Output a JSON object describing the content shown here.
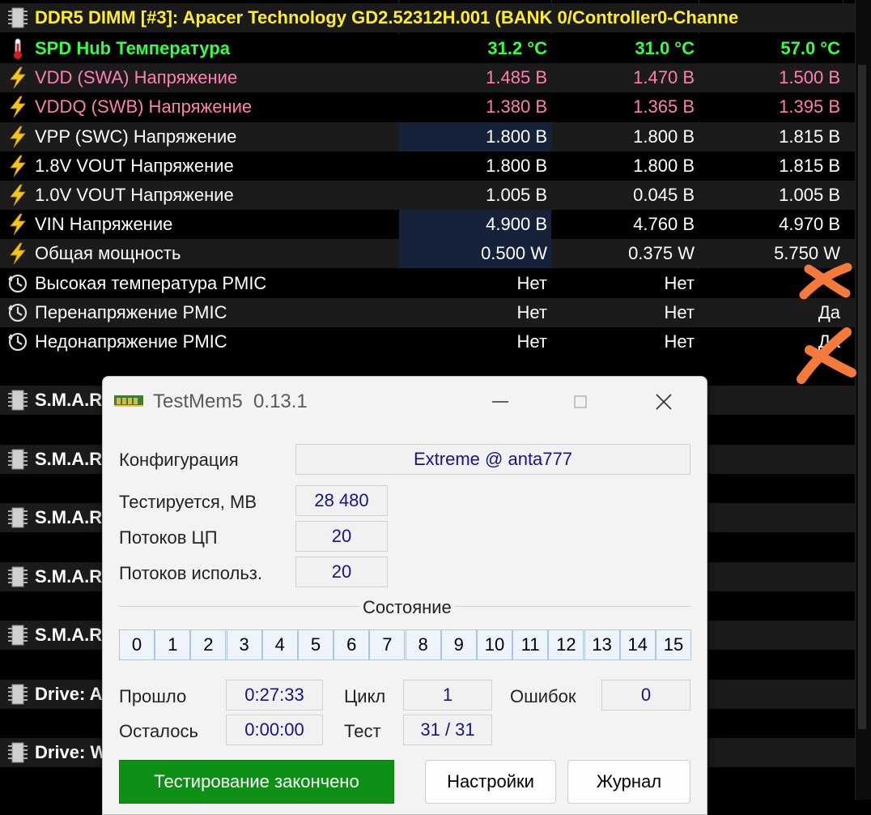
{
  "sensor": {
    "header": "DDR5 DIMM [#3]: Apacer Technology GD2.52312H.001 (BANK 0/Controller0-Channe",
    "rows": [
      {
        "label": "SPD Hub Температура",
        "cur": "31.2 °C",
        "min": "31.0 °C",
        "max": "57.0 °C",
        "icon": "thermometer-icon"
      },
      {
        "label": "VDD (SWA) Напряжение",
        "cur": "1.485 В",
        "min": "1.470 В",
        "max": "1.500 В",
        "icon": "bolt-icon"
      },
      {
        "label": "VDDQ (SWB) Напряжение",
        "cur": "1.380 В",
        "min": "1.365 В",
        "max": "1.395 В",
        "icon": "bolt-icon"
      },
      {
        "label": "VPP (SWC) Напряжение",
        "cur": "1.800 В",
        "min": "1.800 В",
        "max": "1.815 В",
        "icon": "bolt-icon"
      },
      {
        "label": "1.8V VOUT Напряжение",
        "cur": "1.800 В",
        "min": "1.800 В",
        "max": "1.815 В",
        "icon": "bolt-icon"
      },
      {
        "label": "1.0V VOUT Напряжение",
        "cur": "1.005 В",
        "min": "0.045 В",
        "max": "1.005 В",
        "icon": "bolt-icon"
      },
      {
        "label": "VIN Напряжение",
        "cur": "4.900 В",
        "min": "4.760 В",
        "max": "4.970 В",
        "icon": "bolt-icon"
      },
      {
        "label": "Общая мощность",
        "cur": "0.500 W",
        "min": "0.375 W",
        "max": "5.750 W",
        "icon": "bolt-icon"
      },
      {
        "label": "Высокая температура PMIC",
        "cur": "Нет",
        "min": "Нет",
        "max": "",
        "icon": "clock-icon"
      },
      {
        "label": "Перенапряжение PMIC",
        "cur": "Нет",
        "min": "Нет",
        "max": "Да",
        "icon": "clock-icon"
      },
      {
        "label": "Недонапряжение PMIC",
        "cur": "Нет",
        "min": "Нет",
        "max": "Да",
        "icon": "clock-icon"
      }
    ],
    "groups": [
      "S.M.A.R",
      "S.M.A.R",
      "S.M.A.R",
      "S.M.A.R",
      "S.M.A.R",
      "Drive: A",
      "Drive: W"
    ]
  },
  "window": {
    "title": "TestMem5",
    "version": "0.13.1",
    "config_label": "Конфигурация",
    "config_value": "Extreme @ anta777",
    "tested_label": "Тестируется, MB",
    "tested_value": "28 480",
    "cpu_threads_label": "Потоков ЦП",
    "cpu_threads_value": "20",
    "used_threads_label": "Потоков использ.",
    "used_threads_value": "20",
    "state_label": "Состояние",
    "threads": [
      "0",
      "1",
      "2",
      "3",
      "4",
      "5",
      "6",
      "7",
      "8",
      "9",
      "10",
      "11",
      "12",
      "13",
      "14",
      "15"
    ],
    "elapsed_label": "Прошло",
    "elapsed_value": "0:27:33",
    "remaining_label": "Осталось",
    "remaining_value": "0:00:00",
    "cycle_label": "Цикл",
    "cycle_value": "1",
    "test_label": "Тест",
    "test_value": "31 / 31",
    "errors_label": "Ошибок",
    "errors_value": "0",
    "status_button": "Тестирование закончено",
    "settings_button": "Настройки",
    "log_button": "Журнал"
  },
  "colors": {
    "header": "#ffee22",
    "temperature": "#33ff44",
    "pink_voltage": "#ff7eb3",
    "orange_mark": "#f47a3c",
    "status_green": "#0e8f16"
  }
}
